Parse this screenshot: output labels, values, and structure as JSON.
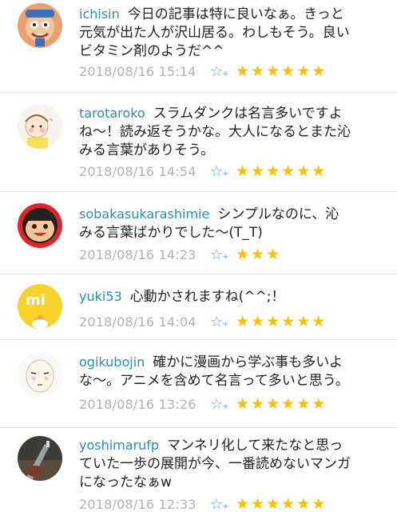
{
  "comments": [
    {
      "user": "ichisin",
      "text": "今日の記事は特に良いなぁ。きっと元気が出た人が沢山居る。わしもそう。良いビタミン剤のようだ^^",
      "timestamp": "2018/08/16 15:14",
      "rating": 6,
      "avatar_icon": "wrestler-face-avatar-icon"
    },
    {
      "user": "tarotaroko",
      "text": "スラムダンクは名言多いですよね〜！読み返そうかな。大人になるとまた沁みる言葉がありそう。",
      "timestamp": "2018/08/16 14:54",
      "rating": 6,
      "avatar_icon": "child-drawing-avatar-icon"
    },
    {
      "user": "sobakasukarashimie",
      "text": "シンプルなのに、沁みる言葉ばかりでした〜(T_T)",
      "timestamp": "2018/08/16 14:23",
      "rating": 3,
      "avatar_icon": "cartoon-face-avatar-icon"
    },
    {
      "user": "yuki53",
      "text": "心動かされますね(^^;！",
      "timestamp": "2018/08/16 14:04",
      "rating": 6,
      "avatar_icon": "yellow-mi-chick-avatar-icon"
    },
    {
      "user": "ogikubojin",
      "text": "確かに漫画から学ぶ事も多いよな〜。アニメを含めて名言って多いと思う。",
      "timestamp": "2018/08/16 13:26",
      "rating": 6,
      "avatar_icon": "sketch-face-avatar-icon"
    },
    {
      "user": "yoshimarufp",
      "text": "マンネリ化して来たなと思っていた一歩の展開が今、一番読めないマンガになったなぁw",
      "timestamp": "2018/08/16 12:33",
      "rating": 6,
      "avatar_icon": "guitar-photo-avatar-icon"
    }
  ],
  "icons": {
    "favorite": "star-plus-icon",
    "rating_star": "filled-star-icon"
  },
  "colors": {
    "username": "#2c8cb4",
    "timestamp": "#b2b2b2",
    "star": "#ffbf00",
    "favorite": "#6aa6d8"
  }
}
